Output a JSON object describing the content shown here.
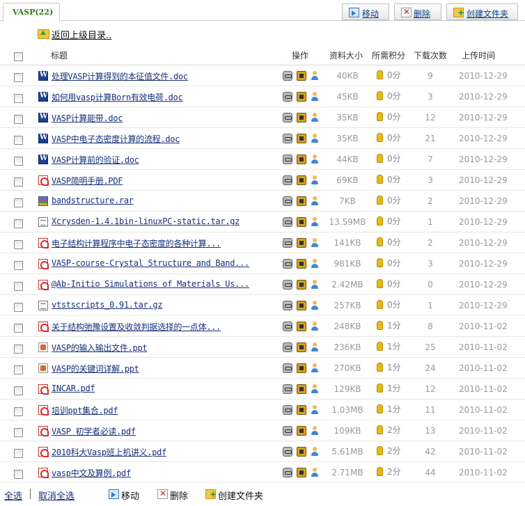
{
  "tab": {
    "label": "VASP(22)"
  },
  "toolbar": {
    "move": "移动",
    "delete": "删除",
    "create_folder": "创建文件夹"
  },
  "back_label": "返回上级目录..",
  "columns": {
    "title": "标题",
    "ops": "操作",
    "size": "资料大小",
    "points": "所需积分",
    "downloads": "下载次数",
    "upload": "上传时间"
  },
  "rows": [
    {
      "type": "word",
      "name": "处理VASP计算得到的本征值文件.doc",
      "size": "40KB",
      "points": "0分",
      "downloads": "9",
      "date": "2010-12-29"
    },
    {
      "type": "word",
      "name": "如何用vasp计算Born有效电荷.doc",
      "size": "45KB",
      "points": "0分",
      "downloads": "3",
      "date": "2010-12-29"
    },
    {
      "type": "word",
      "name": "VASP计算能带.doc",
      "size": "35KB",
      "points": "0分",
      "downloads": "12",
      "date": "2010-12-29"
    },
    {
      "type": "word",
      "name": "VASP中电子态密度计算的流程.doc",
      "size": "35KB",
      "points": "0分",
      "downloads": "21",
      "date": "2010-12-29"
    },
    {
      "type": "word",
      "name": "VASP计算前的验证.doc",
      "size": "44KB",
      "points": "0分",
      "downloads": "7",
      "date": "2010-12-29"
    },
    {
      "type": "pdf",
      "name": "VASP简明手册.PDF",
      "size": "69KB",
      "points": "0分",
      "downloads": "3",
      "date": "2010-12-29"
    },
    {
      "type": "rar",
      "name": "bandstructure.rar",
      "size": "7KB",
      "points": "0分",
      "downloads": "2",
      "date": "2010-12-29"
    },
    {
      "type": "txt",
      "name": "Xcrysden-1.4.1bin-linuxPC-static.tar.gz",
      "size": "13.59MB",
      "points": "0分",
      "downloads": "1",
      "date": "2010-12-29"
    },
    {
      "type": "pdf",
      "name": "电子结构计算程序中电子态密度的各种计算...",
      "size": "141KB",
      "points": "0分",
      "downloads": "2",
      "date": "2010-12-29"
    },
    {
      "type": "pdf",
      "name": "VASP-course-Crystal Structure and Band...",
      "size": "981KB",
      "points": "0分",
      "downloads": "3",
      "date": "2010-12-29"
    },
    {
      "type": "pdf",
      "name": "@Ab-Initio Simulations of Materials Us...",
      "size": "2.42MB",
      "points": "0分",
      "downloads": "0",
      "date": "2010-12-29"
    },
    {
      "type": "txt",
      "name": "vtstscripts_0.91.tar.gz",
      "size": "257KB",
      "points": "0分",
      "downloads": "1",
      "date": "2010-12-29"
    },
    {
      "type": "pdf",
      "name": "关于结构弛豫设置及收敛判据选择的一点体...",
      "size": "248KB",
      "points": "1分",
      "downloads": "8",
      "date": "2010-11-02"
    },
    {
      "type": "ppt",
      "name": "VASP的输入输出文件.ppt",
      "size": "236KB",
      "points": "1分",
      "downloads": "25",
      "date": "2010-11-02"
    },
    {
      "type": "ppt",
      "name": "VASP的关键词详解.ppt",
      "size": "270KB",
      "points": "1分",
      "downloads": "24",
      "date": "2010-11-02"
    },
    {
      "type": "pdf",
      "name": "INCAR.pdf",
      "size": "129KB",
      "points": "1分",
      "downloads": "12",
      "date": "2010-11-02"
    },
    {
      "type": "pdf",
      "name": "培训ppt集合.pdf",
      "size": "1.03MB",
      "points": "1分",
      "downloads": "11",
      "date": "2010-11-02"
    },
    {
      "type": "pdf",
      "name": "VASP 初学者必读.pdf",
      "size": "109KB",
      "points": "2分",
      "downloads": "13",
      "date": "2010-11-02"
    },
    {
      "type": "pdf",
      "name": "2010科大Vasp班上机讲义.pdf",
      "size": "5.61MB",
      "points": "2分",
      "downloads": "42",
      "date": "2010-11-02"
    },
    {
      "type": "pdf",
      "name": "vasp中文及算例.pdf",
      "size": "2.71MB",
      "points": "2分",
      "downloads": "44",
      "date": "2010-11-02"
    }
  ],
  "footer": {
    "select_all": "全选",
    "deselect_all": "取消全选",
    "move": "移动",
    "delete": "删除",
    "create_folder": "创建文件夹"
  }
}
